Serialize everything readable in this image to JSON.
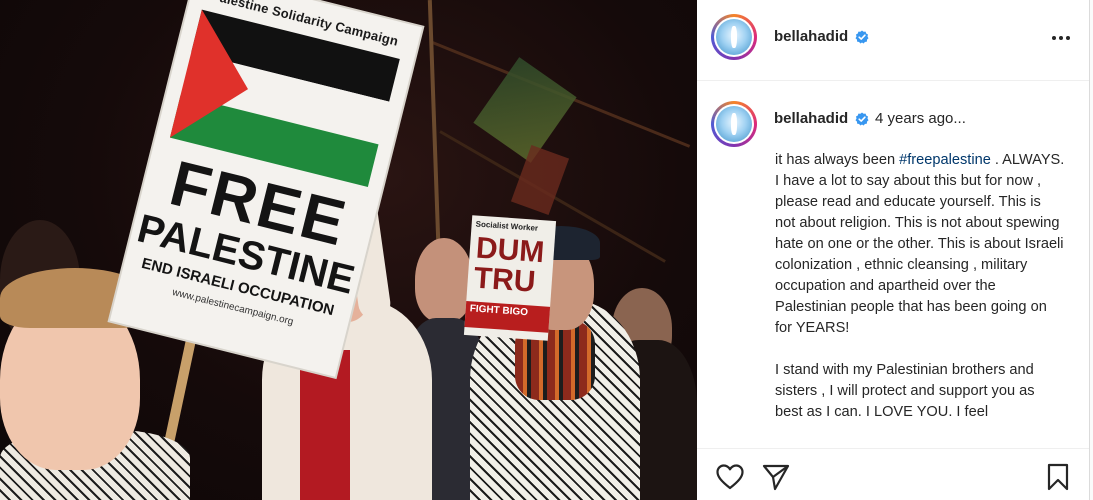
{
  "photo": {
    "placard": {
      "title": "Palestine Solidarity Campaign",
      "line1": "FREE",
      "line2": "PALESTINE",
      "line3": "END ISRAELI OCCUPATION",
      "website": "www.palestinecampaign.org",
      "flag_colors": {
        "black": "#111111",
        "white": "#f4f2ee",
        "green": "#1f8a3c",
        "red": "#e0312b"
      }
    },
    "sign": {
      "top": "Socialist Worker",
      "big": "DUM TRU",
      "bottom": "FIGHT BIGO"
    }
  },
  "post": {
    "header": {
      "username": "bellahadid",
      "more_label": "More options"
    },
    "caption": {
      "username": "bellahadid",
      "time_ago": "4 years ago...",
      "intro_before": "it has always been ",
      "hashtag": "#freepalestine",
      "intro_after": " . ALWAYS. I have a lot to say about this but for now , please read and educate yourself. This is not about religion. This is not about spewing hate on one or the other. This is about Israeli colonization , ethnic cleansing , military occupation and apartheid over the Palestinian people that has been going on for YEARS!",
      "paragraph2": "I stand with my Palestinian brothers and sisters , I will protect and support you as best as I can. I LOVE YOU. I feel"
    },
    "actions": {
      "like": "heart-icon",
      "share": "paper-plane-icon",
      "save": "bookmark-icon"
    },
    "colors": {
      "verified": "#3897f0",
      "hashtag": "#00376b",
      "text": "#262626",
      "border": "#efefef"
    }
  }
}
